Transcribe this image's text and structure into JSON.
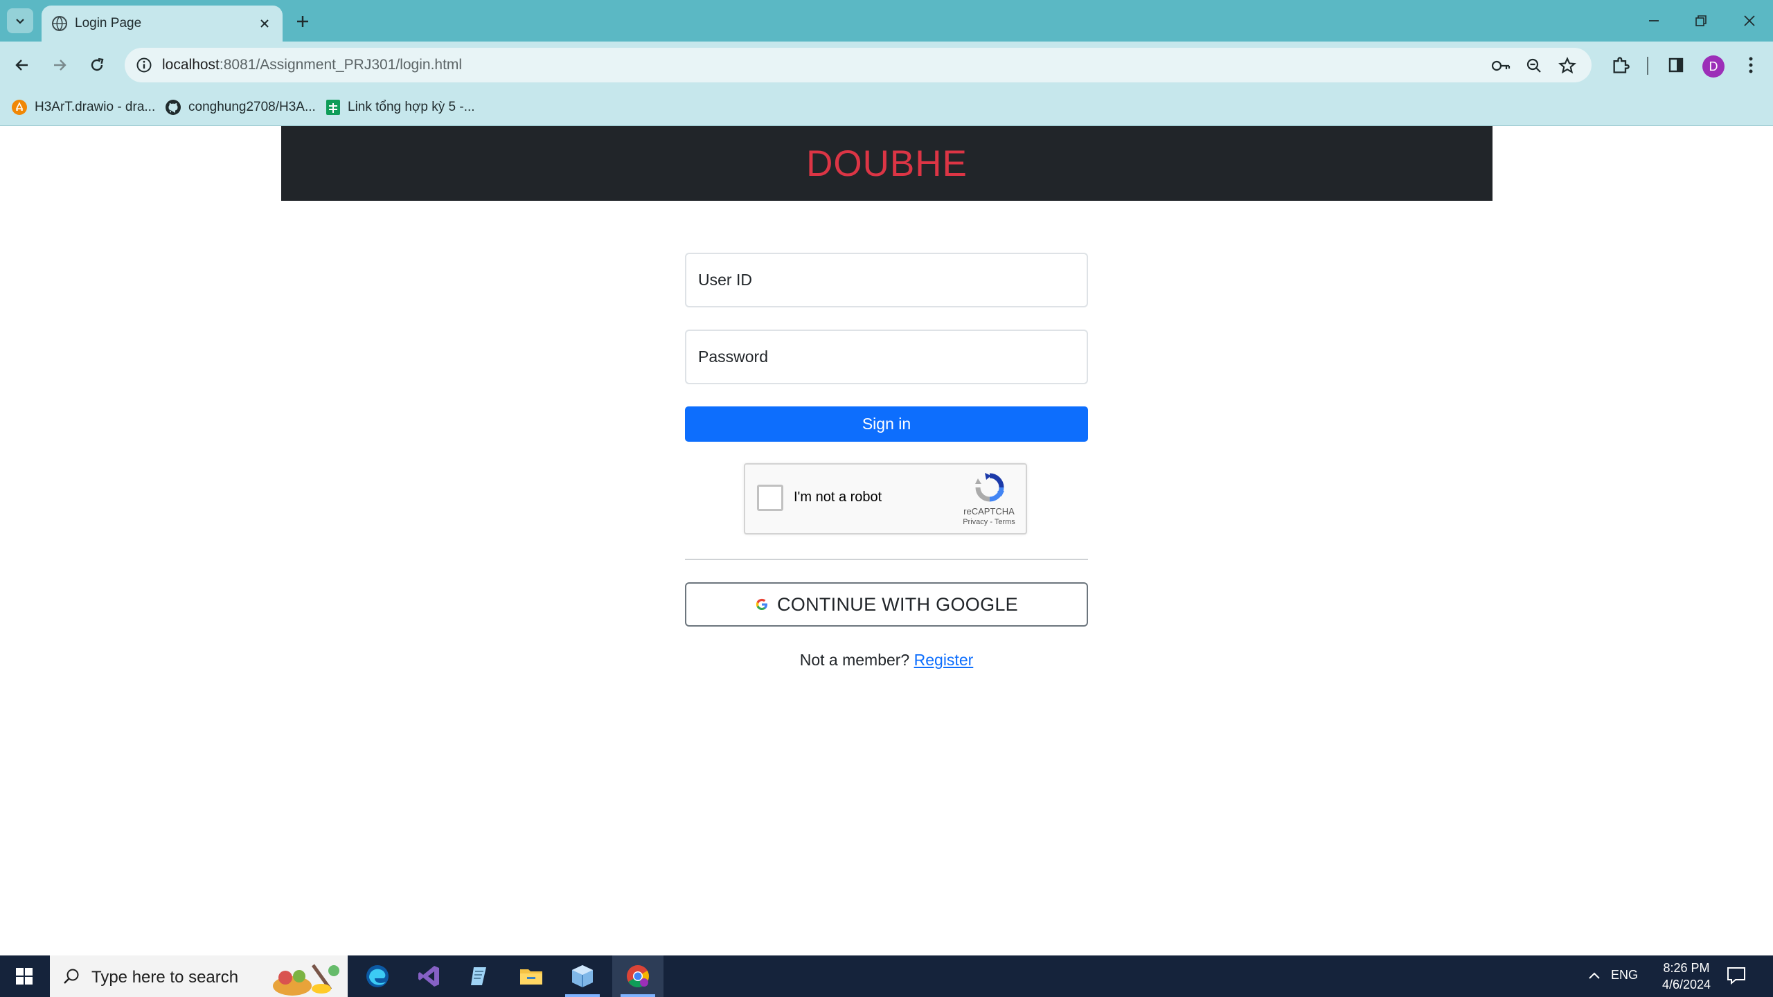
{
  "browser": {
    "tab": {
      "title": "Login Page"
    },
    "url": {
      "host": "localhost",
      "path": ":8081/Assignment_PRJ301/login.html"
    },
    "avatar_letter": "D",
    "bookmarks": [
      {
        "label": "H3ArT.drawio - dra..."
      },
      {
        "label": "conghung2708/H3A..."
      },
      {
        "label": "Link tổng hợp kỳ 5 -..."
      }
    ]
  },
  "page": {
    "brand": "DOUBHE",
    "userid_placeholder": "User ID",
    "password_placeholder": "Password",
    "signin_label": "Sign in",
    "recaptcha": {
      "label": "I'm not a robot",
      "brand": "reCAPTCHA",
      "links": "Privacy - Terms"
    },
    "google_label": "CONTINUE WITH GOOGLE",
    "member_text": "Not a member?",
    "register_label": "Register"
  },
  "taskbar": {
    "search_placeholder": "Type here to search",
    "lang": "ENG",
    "time": "8:26 PM",
    "date": "4/6/2024"
  },
  "colors": {
    "tabstrip": "#5bb8c4",
    "toolbar": "#c6e7ec",
    "header_bg": "#212529",
    "brand": "#dc3545",
    "primary": "#0d6efd",
    "taskbar": "#15233b"
  }
}
